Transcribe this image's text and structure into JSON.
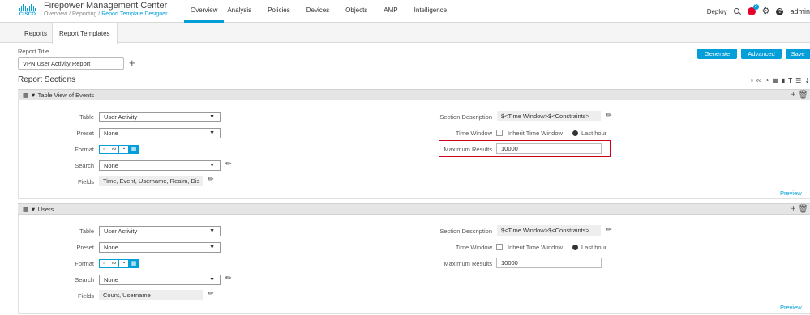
{
  "header": {
    "app_title": "Firepower Management Center",
    "breadcrumb_path": "Overview / Reporting / ",
    "breadcrumb_current": "Report Template Designer",
    "logo_text": "CISCO",
    "nav": [
      "Overview",
      "Analysis",
      "Policies",
      "Devices",
      "Objects",
      "AMP",
      "Intelligence"
    ],
    "active_nav": "Overview",
    "deploy_label": "Deploy",
    "alert_badge": "2",
    "user": "admin"
  },
  "subtabs": [
    "Reports",
    "Report Templates"
  ],
  "report": {
    "title_label": "Report Title",
    "title_value": "VPN User Activity Report",
    "add_icon": "+",
    "buttons": {
      "generate": "Generate",
      "advanced": "Advanced",
      "save": "Save"
    },
    "sections_heading": "Report Sections",
    "toolbar_icons": [
      "bar-chart-icon",
      "line-chart-icon",
      "pie-chart-icon",
      "table-icon",
      "document-icon",
      "text-icon",
      "page-break-icon",
      "import-icon"
    ]
  },
  "sections": [
    {
      "name": "Table View of Events",
      "labels": {
        "table": "Table",
        "preset": "Preset",
        "format": "Format",
        "search": "Search",
        "fields": "Fields"
      },
      "table": "User Activity",
      "preset": "None",
      "search": "None",
      "fields": "Time, Event, Username, Realm, Dis",
      "right_labels": {
        "description": "Section Description",
        "time_window": "Time Window",
        "max_results": "Maximum Results"
      },
      "description": "$<Time Window>$<Constraints>",
      "inherit_label": "Inherit Time Window",
      "time_value": "Last hour",
      "max_results": "10000",
      "preview": "Preview"
    },
    {
      "name": "Users",
      "labels": {
        "table": "Table",
        "preset": "Preset",
        "format": "Format",
        "search": "Search",
        "fields": "Fields"
      },
      "table": "User Activity",
      "preset": "None",
      "search": "None",
      "fields": "Count, Username",
      "right_labels": {
        "description": "Section Description",
        "time_window": "Time Window",
        "max_results": "Maximum Results"
      },
      "description": "$<Time Window>$<Constraints>",
      "inherit_label": "Inherit Time Window",
      "time_value": "Last hour",
      "max_results": "10000",
      "preview": "Preview"
    }
  ],
  "colors": {
    "accent": "#049fd9",
    "highlight": "#d0021b",
    "alert": "#e4002b"
  }
}
